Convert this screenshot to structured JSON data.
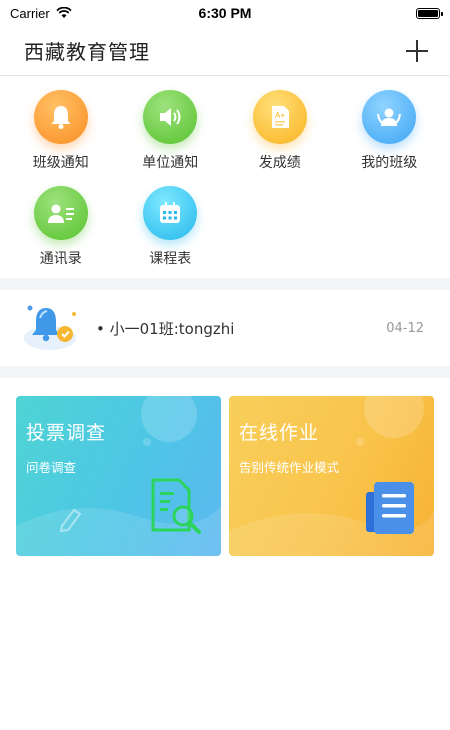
{
  "status_bar": {
    "carrier": "Carrier",
    "time": "6:30 PM"
  },
  "nav": {
    "title": "西藏教育管理"
  },
  "grid": [
    {
      "label": "班级通知",
      "icon": "bell-icon",
      "color": "#fb8d24"
    },
    {
      "label": "单位通知",
      "icon": "speaker-icon",
      "color": "#58c22e"
    },
    {
      "label": "发成绩",
      "icon": "grade-paper-icon",
      "color": "#f9b21f"
    },
    {
      "label": "我的班级",
      "icon": "class-people-icon",
      "color": "#3ea5f5"
    },
    {
      "label": "通讯录",
      "icon": "contact-card-icon",
      "color": "#58c22e"
    },
    {
      "label": "课程表",
      "icon": "calendar-icon",
      "color": "#24b8ec"
    }
  ],
  "notice": {
    "text": "小一01班:tongzhi",
    "date": "04-12"
  },
  "cards": [
    {
      "title": "投票调查",
      "subtitle": "问卷调查"
    },
    {
      "title": "在线作业",
      "subtitle": "告别传统作业模式"
    }
  ]
}
